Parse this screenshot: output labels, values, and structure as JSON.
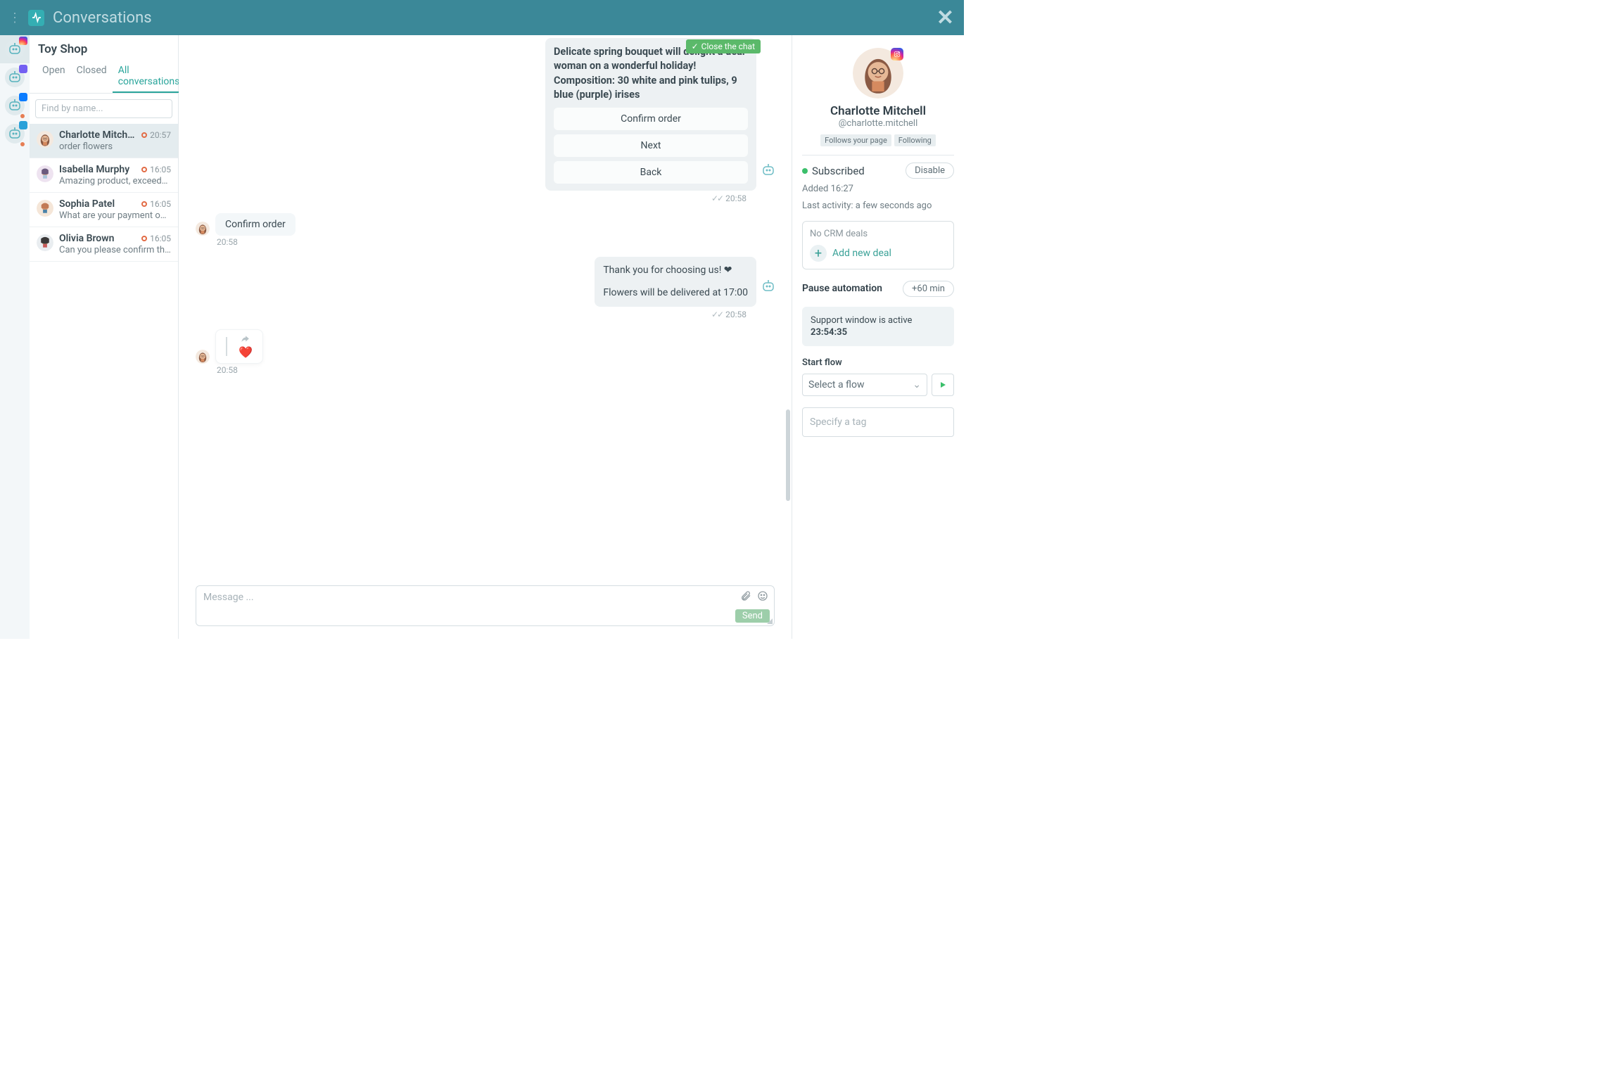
{
  "topbar": {
    "title": "Conversations"
  },
  "channels": [
    {
      "id": "instagram",
      "color": "#e1306c",
      "active": true
    },
    {
      "id": "viber",
      "color": "#7360f2"
    },
    {
      "id": "messenger",
      "color": "#0084ff",
      "dot": true
    },
    {
      "id": "telegram",
      "color": "#2aa1d9",
      "dot": true
    }
  ],
  "sidebar": {
    "shop": "Toy Shop",
    "tabs": {
      "open": "Open",
      "closed": "Closed",
      "all": "All conversations"
    },
    "search_placeholder": "Find by name...",
    "items": [
      {
        "name": "Charlotte Mitchell",
        "preview": "order flowers",
        "time": "20:57",
        "active": true,
        "av": "#d79b7a"
      },
      {
        "name": "Isabella Murphy",
        "preview": "Amazing product, exceeded expe…",
        "time": "16:05",
        "av": "#6b5a7d"
      },
      {
        "name": "Sophia Patel",
        "preview": "What are your payment options?",
        "time": "16:05",
        "av": "#c27a55"
      },
      {
        "name": "Olivia Brown",
        "preview": "Can you please confirm the estim…",
        "time": "16:05",
        "av": "#4d4a4a"
      }
    ]
  },
  "chat": {
    "close_btn": "Close the chat",
    "bot1": {
      "text": "Delicate spring bouquet will delight a dear woman on a wonderful holiday! Composition: 30 white and pink tulips, 9 blue (purple) irises",
      "buttons": {
        "confirm": "Confirm order",
        "next": "Next",
        "back": "Back"
      }
    },
    "ts1": "20:58",
    "user1": {
      "text": "Confirm order",
      "ts": "20:58"
    },
    "bot2": {
      "line1": "Thank you for choosing us! ❤",
      "line2": "Flowers will be delivered at 17:00"
    },
    "ts2": "20:58",
    "reply": {
      "heart": "❤️",
      "ts": "20:58"
    },
    "composer": {
      "placeholder": "Message ...",
      "send": "Send"
    }
  },
  "details": {
    "name": "Charlotte Mitchell",
    "handle": "@charlotte.mitchell",
    "badges": {
      "follows": "Follows your page",
      "following": "Following"
    },
    "subscribed": "Subscribed",
    "disable": "Disable",
    "added": "Added 16:27",
    "last": "Last activity: a few seconds ago",
    "crm": {
      "no_deals": "No CRM deals",
      "add": "Add new deal"
    },
    "pause": {
      "label": "Pause automation",
      "btn": "+60 min"
    },
    "support": {
      "label": "Support window is active",
      "timer": "23:54:35"
    },
    "flow": {
      "label": "Start flow",
      "select": "Select a flow"
    },
    "tag_placeholder": "Specify a tag"
  }
}
